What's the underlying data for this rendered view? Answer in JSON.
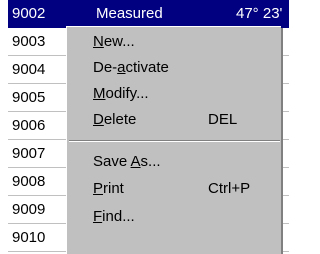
{
  "rows": [
    {
      "id": "9002",
      "col2": "Measured",
      "col3": "47° 23'"
    },
    {
      "id": "9003"
    },
    {
      "id": "9004"
    },
    {
      "id": "9005"
    },
    {
      "id": "9006"
    },
    {
      "id": "9007"
    },
    {
      "id": "9008"
    },
    {
      "id": "9009"
    },
    {
      "id": "9010"
    }
  ],
  "menu": {
    "new": {
      "pre": "",
      "acc": "N",
      "post": "ew..."
    },
    "deactivate": {
      "pre": "De-",
      "acc": "a",
      "post": "ctivate"
    },
    "modify": {
      "pre": "",
      "acc": "M",
      "post": "odify..."
    },
    "delete": {
      "pre": "",
      "acc": "D",
      "post": "elete",
      "shortcut": "DEL"
    },
    "save_as": {
      "pre": "Save ",
      "acc": "A",
      "post": "s..."
    },
    "print": {
      "pre": "",
      "acc": "P",
      "post": "rint",
      "shortcut": "Ctrl+P"
    },
    "find": {
      "pre": "",
      "acc": "F",
      "post": "ind..."
    }
  },
  "colors": {
    "selection": "#000080",
    "menu_bg": "#c0c0c0"
  }
}
